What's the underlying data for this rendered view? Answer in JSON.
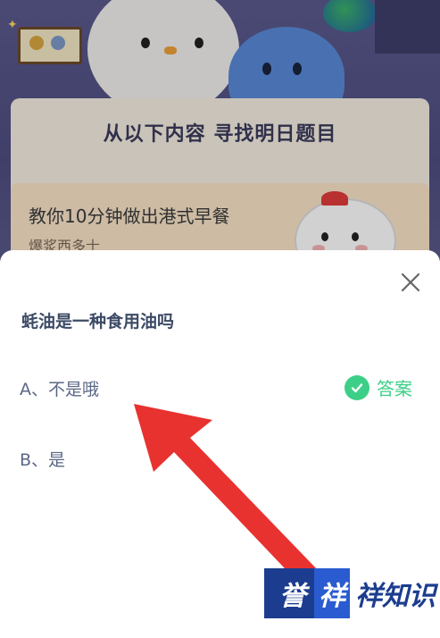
{
  "background": {
    "card_title": "从以下内容 寻找明日题目",
    "item_title": "教你10分钟做出港式早餐",
    "item_subtitle": "爆浆西多士"
  },
  "modal": {
    "question": "蚝油是一种食用油吗",
    "options": [
      {
        "label": "A、不是哦",
        "is_answer": true
      },
      {
        "label": "B、是",
        "is_answer": false
      }
    ],
    "answer_label": "答案",
    "close_icon": "close-icon"
  },
  "watermark": {
    "part1": "誉",
    "part2": "祥",
    "rest": "祥知识"
  },
  "colors": {
    "accent_green": "#3ccf87",
    "question_text": "#3d4b66",
    "arrow_red": "#e8322f",
    "watermark_blue": "#1c3d8f"
  }
}
